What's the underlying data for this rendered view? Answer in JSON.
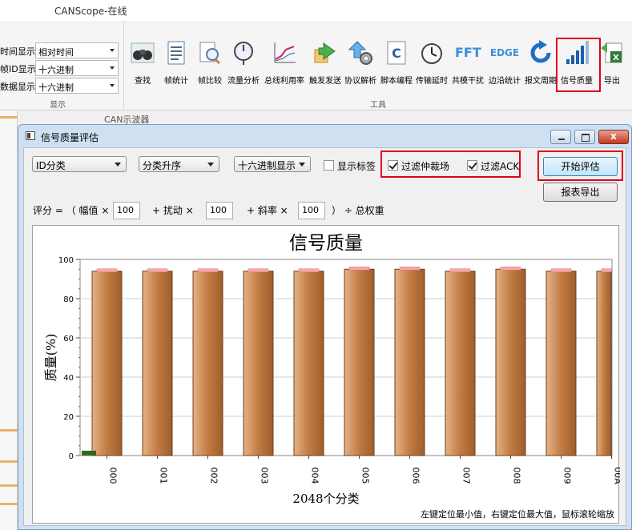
{
  "app": {
    "title": "CANScope-在线"
  },
  "display_group": {
    "label": "显示",
    "rows": [
      {
        "label": "时间显示",
        "value": "相对时间"
      },
      {
        "label": "帧ID显示",
        "value": "十六进制"
      },
      {
        "label": "数据显示",
        "value": "十六进制"
      }
    ]
  },
  "tools_group": {
    "label": "工具",
    "items": [
      {
        "label": "查找",
        "icon": "binoculars-icon"
      },
      {
        "label": "帧统计",
        "icon": "document-list-icon"
      },
      {
        "label": "帧比较",
        "icon": "magnifier-doc-icon"
      },
      {
        "label": "流量分析",
        "icon": "stopwatch-flow-icon"
      },
      {
        "label": "总线利用率",
        "icon": "line-chart-icon"
      },
      {
        "label": "触发发送",
        "icon": "arrow-send-icon"
      },
      {
        "label": "协议解析",
        "icon": "gear-upload-icon"
      },
      {
        "label": "脚本编程",
        "icon": "script-c-icon"
      },
      {
        "label": "传输延时",
        "icon": "clock-icon"
      },
      {
        "label": "共模干扰",
        "icon": "fft-icon"
      },
      {
        "label": "边沿统计",
        "icon": "edge-icon"
      },
      {
        "label": "报文周期",
        "icon": "refresh-icon"
      },
      {
        "label": "信号质量",
        "icon": "signal-bars-icon"
      },
      {
        "label": "导出",
        "icon": "excel-export-icon"
      }
    ],
    "fft_text": "FFT",
    "edge_text": "EDGE"
  },
  "behind_tab": {
    "label": "CAN示波器"
  },
  "dialog": {
    "title": "信号质量评估",
    "close_glyph": "x",
    "controls": {
      "id_class": "ID分类",
      "sort": "分类升序",
      "hex_display": "十六进制显示",
      "show_tags_label": "显示标签",
      "show_tags_checked": false,
      "filter_arbitration_label": "过滤仲裁场",
      "filter_arbitration_checked": true,
      "filter_ack_label": "过滤ACK",
      "filter_ack_checked": true,
      "start_button": "开始评估",
      "export_button": "报表导出"
    },
    "formula": {
      "prefix": "评分 = （ 幅值 ×",
      "amp_weight": "100",
      "plus1": "+  扰动 ×",
      "dist_weight": "100",
      "plus2": "+  斜率 ×",
      "slope_weight": "100",
      "suffix": "） ÷ 总权重"
    }
  },
  "colors": {
    "bar": "#c8804a",
    "bar_highlight": "#e8aa78",
    "cap": "#f4a8a8",
    "highlight_red": "#e0001b"
  },
  "chart_data": {
    "type": "bar",
    "title": "信号质量",
    "ylabel": "质量(%)",
    "xlabel": "2048个分类",
    "categories": [
      "000",
      "001",
      "002",
      "003",
      "004",
      "005",
      "006",
      "007",
      "008",
      "009",
      "00A"
    ],
    "values": [
      94,
      94,
      94,
      94,
      94,
      95,
      95,
      94,
      95,
      94,
      94
    ],
    "ylim": [
      0,
      100
    ],
    "yticks": [
      "0",
      "20",
      "40",
      "60",
      "80",
      "100"
    ],
    "grid": true,
    "footer": "左键定位最小值，右键定位最大值，鼠标滚轮缩放"
  }
}
